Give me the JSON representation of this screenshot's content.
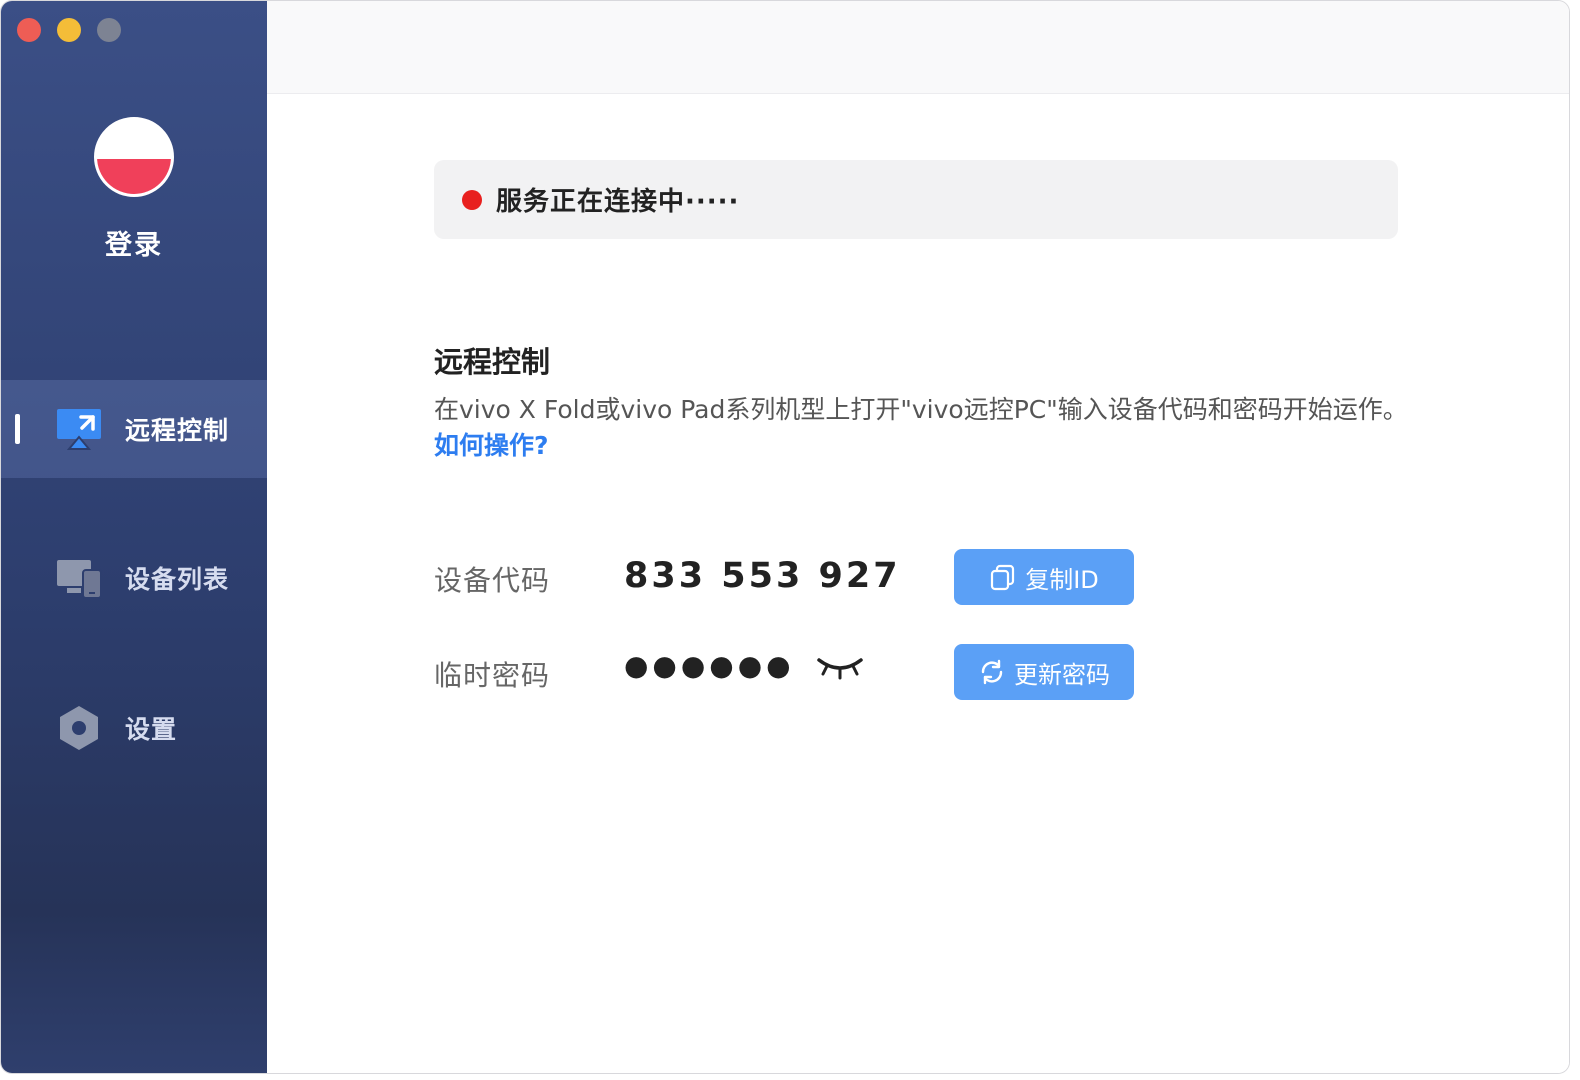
{
  "sidebar": {
    "user": {
      "login_label": "登录"
    },
    "items": [
      {
        "id": "remote",
        "label": "远程控制",
        "icon": "remote-control-icon",
        "active": true
      },
      {
        "id": "devices",
        "label": "设备列表",
        "icon": "devices-icon",
        "active": false
      },
      {
        "id": "settings",
        "label": "设置",
        "icon": "settings-hex-icon",
        "active": false
      }
    ]
  },
  "status": {
    "text": "服务正在连接中·····",
    "dot_color": "#e8201e"
  },
  "remote": {
    "title": "远程控制",
    "description": "在vivo X Fold或vivo Pad系列机型上打开\"vivo远控PC\"输入设备代码和密码开始运作。",
    "help_link": "如何操作?",
    "device_code_label": "设备代码",
    "device_code": "833 553 927",
    "password_label": "临时密码",
    "password_masked": "●●●●●●",
    "copy_button": "复制ID",
    "refresh_button": "更新密码"
  },
  "colors": {
    "accent_button": "#5ba0f6",
    "link": "#2d7df0",
    "sidebar_active_icon": "#3b8bf3"
  }
}
